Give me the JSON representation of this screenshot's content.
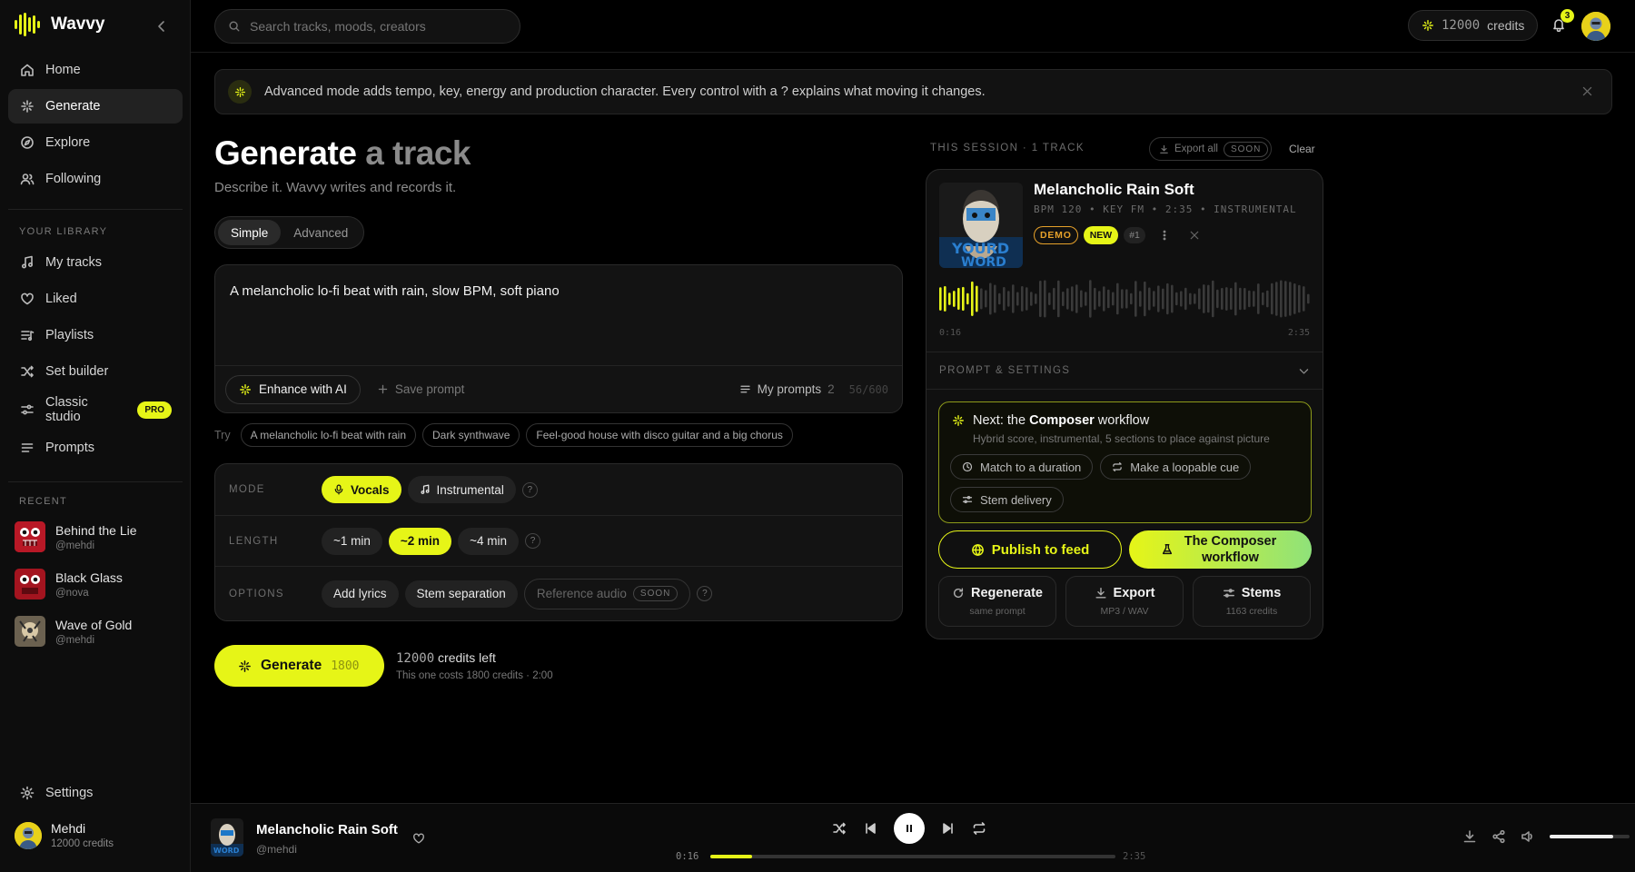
{
  "app": {
    "name": "Wavvy"
  },
  "sidebar": {
    "nav": [
      {
        "label": "Home",
        "icon": "home-icon"
      },
      {
        "label": "Generate",
        "icon": "sparkle-icon",
        "active": true
      },
      {
        "label": "Explore",
        "icon": "compass-icon"
      },
      {
        "label": "Following",
        "icon": "users-icon"
      }
    ],
    "library_label": "YOUR LIBRARY",
    "library": [
      {
        "label": "My tracks",
        "icon": "music-note-icon"
      },
      {
        "label": "Liked",
        "icon": "heart-icon"
      },
      {
        "label": "Playlists",
        "icon": "playlist-icon"
      },
      {
        "label": "Set builder",
        "icon": "shuffle-icon"
      },
      {
        "label": "Classic studio",
        "icon": "sliders-icon",
        "badge": "PRO"
      },
      {
        "label": "Prompts",
        "icon": "list-icon"
      }
    ],
    "recent_label": "RECENT",
    "recent": [
      {
        "title": "Behind the Lie",
        "sub": "@mehdi"
      },
      {
        "title": "Black Glass",
        "sub": "@nova"
      },
      {
        "title": "Wave of Gold",
        "sub": "@mehdi"
      }
    ],
    "settings_label": "Settings",
    "user": {
      "name": "Mehdi",
      "credits": "12000 credits"
    }
  },
  "topbar": {
    "search_placeholder": "Search tracks, moods, creators",
    "credits_num": "12000",
    "credits_label": "credits",
    "notifications": "3"
  },
  "banner": {
    "text": "Advanced mode adds tempo, key, energy and production character. Every control with a ? explains what moving it changes."
  },
  "generate": {
    "title": "Generate",
    "title_dim": "a track",
    "subtitle": "Describe it. Wavvy writes and records it.",
    "tabs": [
      "Simple",
      "Advanced"
    ],
    "prompt": "A melancholic lo-fi beat with rain, slow BPM, soft piano",
    "enhance": "Enhance with AI",
    "save_prompt": "Save prompt",
    "my_prompts": "My prompts",
    "my_prompts_count": "2",
    "char_count": "56/600",
    "try_label": "Try",
    "suggestions": [
      "A melancholic lo-fi beat with rain",
      "Dark synthwave",
      "Feel-good house with disco guitar and a big chorus"
    ],
    "mode_label": "MODE",
    "modes": [
      "Vocals",
      "Instrumental"
    ],
    "length_label": "LENGTH",
    "lengths": [
      "~1 min",
      "~2 min",
      "~4 min"
    ],
    "options_label": "OPTIONS",
    "options": [
      "Add lyrics",
      "Stem separation",
      "Reference audio"
    ],
    "soon": "SOON",
    "help": "?",
    "button_label": "Generate",
    "button_cost": "1800",
    "credits_left_num": "12000",
    "credits_left_label": "credits left",
    "cost_note": "This one costs 1800 credits · 2:00"
  },
  "session": {
    "header": "THIS SESSION · 1 TRACK",
    "export_all": "Export all",
    "soon": "SOON",
    "clear": "Clear",
    "track": {
      "title": "Melancholic Rain Soft",
      "meta": "BPM 120 • KEY FM • 2:35 • INSTRUMENTAL",
      "badges": {
        "demo": "DEMO",
        "new": "NEW",
        "num": "#1"
      },
      "time_current": "0:16",
      "time_total": "2:35",
      "progress": 0.103
    },
    "prompt_settings": "PROMPT & SETTINGS",
    "composer": {
      "title_pre": "Next: the ",
      "title_bold": "Composer",
      "title_post": " workflow",
      "sub": "Hybrid score, instrumental, 5 sections to place against picture",
      "chips": [
        "Match to a duration",
        "Make a loopable cue",
        "Stem delivery"
      ]
    },
    "publish": "Publish to feed",
    "composer_btn": "The Composer workflow",
    "actions": [
      {
        "label": "Regenerate",
        "sub": "same prompt",
        "icon": "refresh-icon"
      },
      {
        "label": "Export",
        "sub": "MP3 / WAV",
        "icon": "download-icon"
      },
      {
        "label": "Stems",
        "sub": "1163 credits",
        "icon": "stems-icon"
      }
    ]
  },
  "player": {
    "title": "Melancholic Rain Soft",
    "artist": "@mehdi",
    "time_current": "0:16",
    "time_total": "2:35",
    "progress": 0.103,
    "volume": 0.8
  },
  "colors": {
    "accent": "#e6f517",
    "background": "#000000",
    "demo": "#e6a12a"
  }
}
